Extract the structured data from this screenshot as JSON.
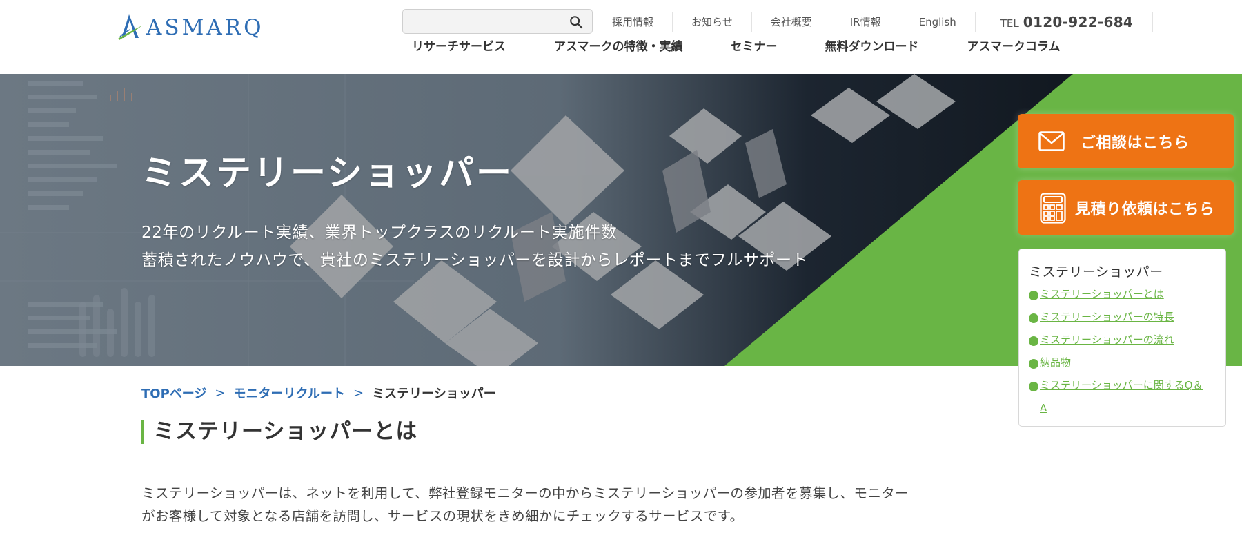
{
  "header": {
    "logo_text": "ASMARQ",
    "search": {
      "value": "",
      "placeholder": ""
    },
    "utility_nav": [
      {
        "label": "採用情報"
      },
      {
        "label": "お知らせ"
      },
      {
        "label": "会社概要"
      },
      {
        "label": "IR情報"
      },
      {
        "label": "English"
      }
    ],
    "tel": {
      "label": "TEL",
      "number": "0120-922-684"
    },
    "main_nav": [
      {
        "label": "リサーチサービス"
      },
      {
        "label": "アスマークの特徴・実績"
      },
      {
        "label": "セミナー"
      },
      {
        "label": "無料ダウンロード"
      },
      {
        "label": "アスマークコラム"
      }
    ]
  },
  "hero": {
    "title": "ミステリーショッパー",
    "subtitle_lines": [
      "22年のリクルート実績、業界トップクラスのリクルート実施件数",
      "蓄積されたノウハウで、貴社のミステリーショッパーを設計からレポートまでフルサポート"
    ]
  },
  "cta": {
    "consult": {
      "label": "ご相談はこちら",
      "icon": "mail-icon"
    },
    "estimate": {
      "label": "見積り依頼はこちら",
      "icon": "calculator-icon"
    }
  },
  "toc": {
    "title": "ミステリーショッパー",
    "items": [
      {
        "label": "ミステリーショッパーとは"
      },
      {
        "label": "ミステリーショッパーの特長"
      },
      {
        "label": "ミステリーショッパーの流れ"
      },
      {
        "label": "納品物"
      },
      {
        "label": "ミステリーショッパーに関するQ＆A"
      }
    ]
  },
  "breadcrumb": {
    "items": [
      {
        "label": "TOPページ"
      },
      {
        "label": "モニターリクルート"
      }
    ],
    "separator": ">",
    "current": "ミステリーショッパー"
  },
  "content": {
    "section_title": "ミステリーショッパーとは",
    "body": "ミステリーショッパーは、ネットを利用して、弊社登録モニターの中からミステリーショッパーの参加者を募集し、モニターがお客様して対象となる店舗を訪問し、サービスの現状をきめ細かにチェックするサービスです。"
  },
  "colors": {
    "brand_blue": "#2e6db4",
    "brand_green": "#6ab544",
    "cta_orange": "#ee7314"
  }
}
